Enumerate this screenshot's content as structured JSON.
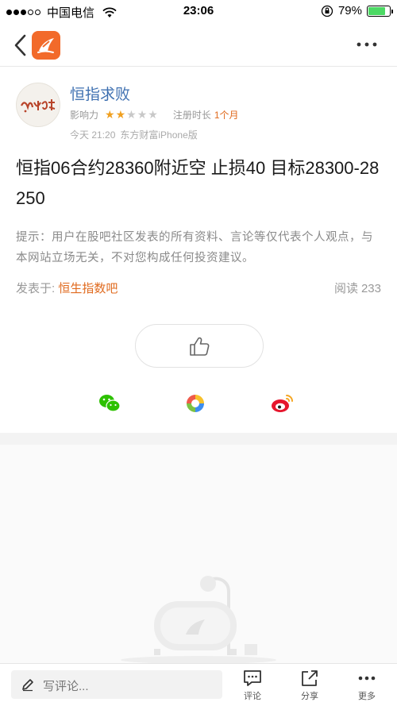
{
  "status_bar": {
    "carrier": "中国电信",
    "time": "23:06",
    "battery_text": "79%",
    "battery_level": 0.79,
    "signal_bars_filled": 3,
    "signal_bars_total": 5
  },
  "nav": {
    "back_icon": "chevron-left-icon",
    "logo_icon": "eastmoney-logo-icon",
    "more_icon": "more-dots-icon"
  },
  "author": {
    "name": "恒指求败",
    "influence_label": "影响力",
    "stars_filled": 2,
    "stars_total": 5,
    "register_label": "注册时长",
    "register_value": "1个月",
    "post_time": "今天 21:20",
    "post_source": "东方财富iPhone版"
  },
  "post": {
    "title": "恒指06合约28360附近空 止损40 目标28300-28250",
    "disclaimer": "提示：用户在股吧社区发表的所有资料、言论等仅代表个人观点，与本网站立场无关，不对您构成任何投资建议。",
    "posted_in_label": "发表于:",
    "forum_name": "恒生指数吧",
    "read_label": "阅读",
    "read_count": "233"
  },
  "like": {
    "icon": "thumbs-up-icon"
  },
  "share": {
    "wechat_icon": "wechat-icon",
    "moments_icon": "wechat-moments-icon",
    "weibo_icon": "weibo-icon"
  },
  "bottom_bar": {
    "comment_placeholder": "写评论...",
    "comment_label": "评论",
    "share_label": "分享",
    "more_label": "更多"
  },
  "colors": {
    "link_blue": "#3d6fb0",
    "accent_orange": "#e06a1e",
    "star_gold": "#f0a020",
    "logo_orange": "#f26a2a"
  }
}
